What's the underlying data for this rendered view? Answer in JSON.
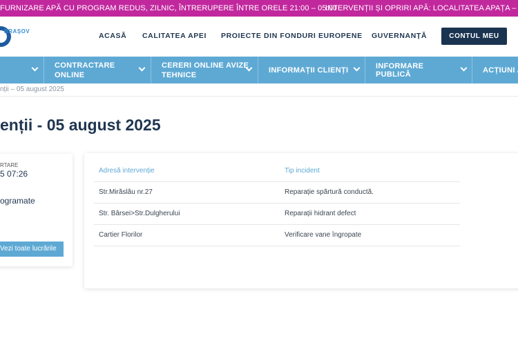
{
  "ticker": {
    "text1": "FURNIZARE APĂ CU PROGRAM REDUS, ZILNIC, ÎNTRERUPERE ÎNTRE ORELE 21:00 – 05:00",
    "text2": "INTERVENȚII ȘI OPRIRI APĂ: LOCALITATEA APAȚA – FURN"
  },
  "header": {
    "logo_text": "BRAȘOV",
    "nav": [
      "ACASĂ",
      "CALITATEA APEI",
      "PROIECTE DIN FONDURI EUROPENE",
      "GUVERNANȚĂ"
    ],
    "account_button": "CONTUL MEU"
  },
  "mainnav": {
    "items": [
      "CONTRACTARE\nONLINE",
      "CERERI ONLINE AVIZE\nTEHNICE",
      "INFORMAȚII CLIENȚI",
      "INFORMARE PUBLICĂ",
      "ACȚIUNI A"
    ]
  },
  "breadcrumb": "nții – 05 august 2025",
  "page_title": "enții - 05 august 2025",
  "left_card": {
    "label": "RTARE",
    "date": "5 07:26",
    "status": "ogramate",
    "button": "Vezi toate lucrările"
  },
  "table": {
    "headers": [
      "Adresă intervenție",
      "Tip incident"
    ],
    "rows": [
      [
        "Str.Mirăslău nr.27",
        "Reparație spărtură conductă."
      ],
      [
        "Str. Bârsei>Str.Dulgherului",
        "Reparații hidrant defect"
      ],
      [
        "Cartier Florilor",
        "Verificare vane îngropate"
      ]
    ]
  },
  "colors": {
    "ticker_bg": "#c2289e",
    "nav_bg": "#5ea9d4",
    "dark_navy": "#1a3350",
    "table_header": "#5ea9d4"
  }
}
